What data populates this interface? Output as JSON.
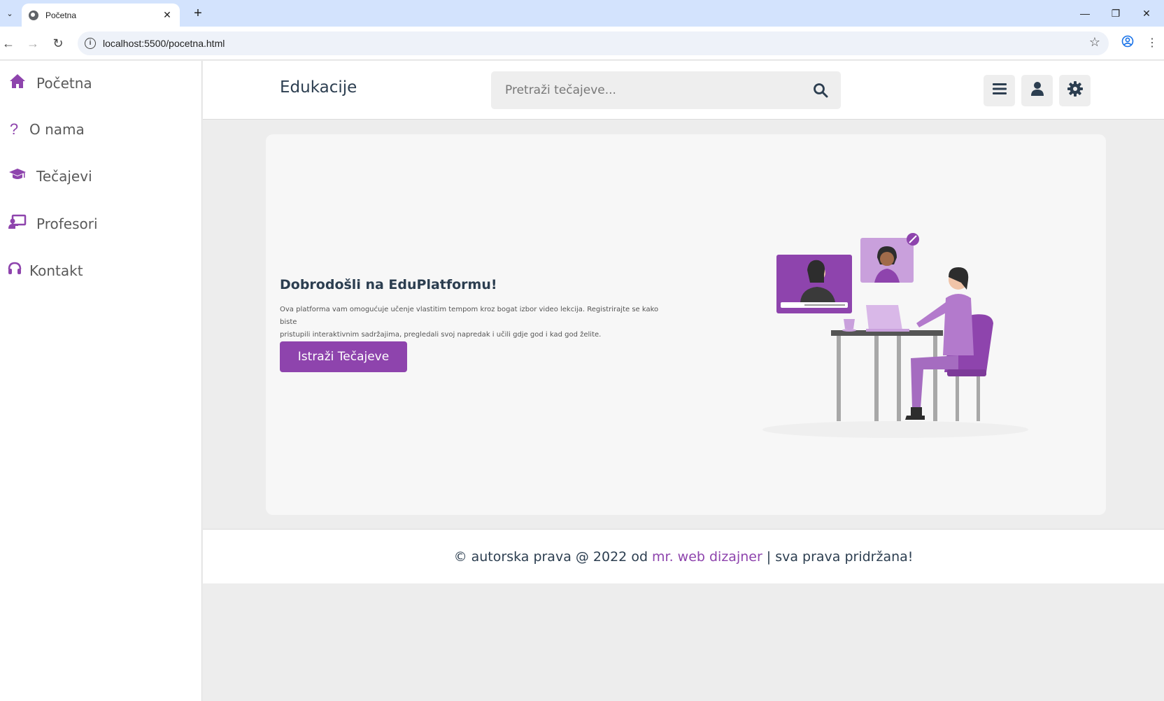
{
  "browser": {
    "tab_title": "Početna",
    "url": "localhost:5500/pocetna.html"
  },
  "sidebar": {
    "items": [
      {
        "label": "Početna",
        "icon": "home-icon"
      },
      {
        "label": "O nama",
        "icon": "question-icon"
      },
      {
        "label": "Tečajevi",
        "icon": "graduation-cap-icon"
      },
      {
        "label": "Profesori",
        "icon": "chalkboard-teacher-icon"
      },
      {
        "label": "Kontakt",
        "icon": "headset-icon"
      }
    ]
  },
  "header": {
    "logo": "Edukacije",
    "search_placeholder": "Pretraži tečajeve..."
  },
  "hero": {
    "title": "Dobrodošli na EduPlatformu!",
    "text_line1": "Ova platforma vam omogućuje učenje vlastitim tempom kroz bogat izbor video lekcija. Registrirajte se kako biste",
    "text_line2": "pristupili interaktivnim sadržajima, pregledali svoj napredak i učili gdje god i kad god želite.",
    "button_label": "Istraži Tečajeve"
  },
  "footer": {
    "prefix": "© autorska prava @ 2022 od",
    "link": "mr. web dizajner",
    "suffix": "| sva prava pridržana!"
  },
  "colors": {
    "accent": "#8e44ad",
    "text_dark": "#2c3e50",
    "chrome_tabstrip": "#d3e3fd"
  }
}
